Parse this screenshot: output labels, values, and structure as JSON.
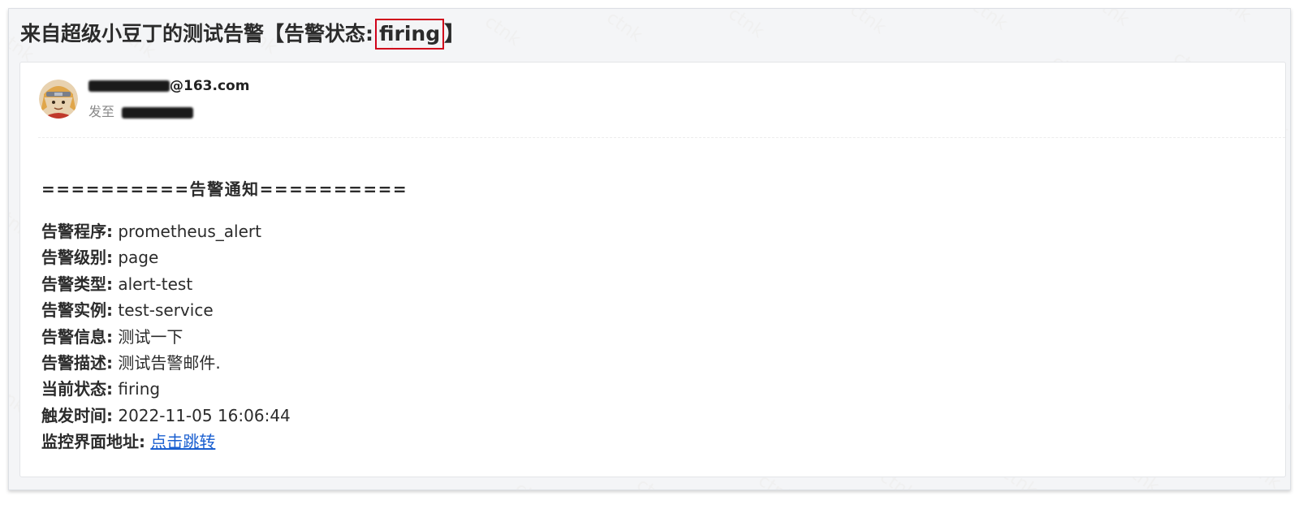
{
  "subject": {
    "prefix": "来自超级小豆丁的测试告警【告警状态:",
    "status": "firing",
    "suffix": "】"
  },
  "sender": {
    "email_suffix": "@163.com",
    "to_label": "发至"
  },
  "notice": {
    "heading": "==========告警通知==========",
    "fields": [
      {
        "label": "告警程序:",
        "value": "prometheus_alert"
      },
      {
        "label": "告警级别:",
        "value": "page"
      },
      {
        "label": "告警类型:",
        "value": "alert-test"
      },
      {
        "label": "告警实例:",
        "value": "test-service"
      },
      {
        "label": "告警信息:",
        "value": "测试一下"
      },
      {
        "label": "告警描述:",
        "value": "测试告警邮件."
      },
      {
        "label": "当前状态:",
        "value": "firing"
      },
      {
        "label": "触发时间:",
        "value": "2022-11-05 16:06:44"
      },
      {
        "label": "监控界面地址:",
        "value": "点击跳转"
      }
    ]
  },
  "colors": {
    "status_box_border": "#d0021b",
    "link": "#1a5fd0",
    "background": "#f4f5f7"
  }
}
